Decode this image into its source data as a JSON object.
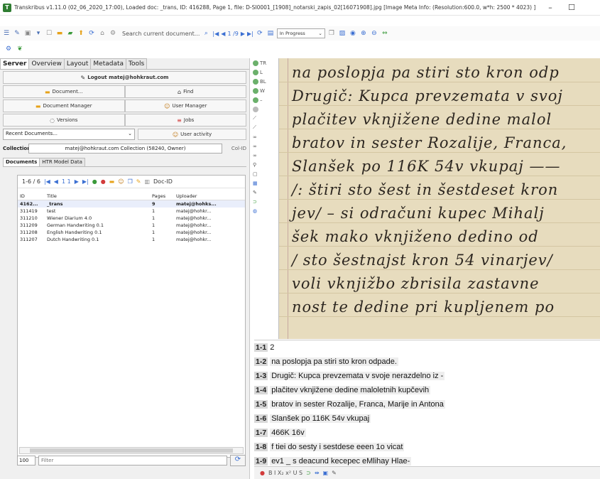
{
  "window": {
    "title": "Transkribus v1.11.0 (02_06_2020_17:00), Loaded doc: _trans, ID: 416288, Page 1, file: D-SI0001_[1908]_notarski_zapis_02[16071908].jpg [Image Meta Info: (Resolution:600.0, w*h: 2500 * 4023) ]",
    "minimize": "–",
    "maximize": "☐"
  },
  "toolbar": {
    "search_placeholder": "Search current document...",
    "page_indicator": "1 /9",
    "status": "In Progress"
  },
  "left_tabs": [
    "Server",
    "Overview",
    "Layout",
    "Metadata",
    "Tools"
  ],
  "server": {
    "logout": "Logout matej@hohkraut.com",
    "document": "Document...",
    "find": "Find",
    "doc_manager": "Document Manager",
    "user_manager": "User Manager",
    "versions": "Versions",
    "jobs": "Jobs",
    "recent": "Recent Documents...",
    "user_activity": "User activity",
    "collections_label": "Collections:",
    "collection_value": "matej@hohkraut.com Collection (58240, Owner)",
    "col_id": "Col-ID"
  },
  "sub_tabs": [
    "Documents",
    "HTR Model Data"
  ],
  "docs": {
    "count": "1-6 / 6",
    "page": "1 1",
    "doc_id": "Doc-ID",
    "columns": [
      "ID",
      "Title",
      "Pages",
      "Uploader"
    ],
    "rows": [
      {
        "id": "4162...",
        "title": "_trans",
        "pages": "9",
        "uploader": "matej@hohks..."
      },
      {
        "id": "311419",
        "title": "test",
        "pages": "1",
        "uploader": "matej@hohkr..."
      },
      {
        "id": "311210",
        "title": "Wiener Diarium 4.0",
        "pages": "1",
        "uploader": "matej@hohkr..."
      },
      {
        "id": "311209",
        "title": "German Handwriting 0.1",
        "pages": "1",
        "uploader": "matej@hohkr..."
      },
      {
        "id": "311208",
        "title": "English Handwriting 0.1",
        "pages": "1",
        "uploader": "matej@hohkr..."
      },
      {
        "id": "311207",
        "title": "Dutch Handwriting 0.1",
        "pages": "1",
        "uploader": "matej@hohkr..."
      }
    ],
    "page_size": "100",
    "filter_placeholder": "Filter"
  },
  "vstrip": [
    "TR",
    "L",
    "BL",
    "W",
    "–",
    "",
    "",
    "",
    "",
    "",
    ""
  ],
  "handwriting": [
    "na poslopja pa stiri sto kron odp",
    "Drugič: Kupca prevzemata v svoj",
    "plačitev vknjižene dedine malol",
    "bratov in sester Rozalije, Franca,",
    "Slanšek po 116K 54v vkupaj ——",
    "/: štiri sto šest in šestdeset kron",
    "jev/ – si odračuni kupec Mihalj",
    "šek mako vknjiženo dedino od",
    "/ sto šestnajst kron 54 vinarjev/",
    "voli vknjižbo zbrisila zastavne",
    "nost te dedine pri kupljenem po"
  ],
  "transcription": [
    {
      "num": "1-1",
      "text": "2"
    },
    {
      "num": "1-2",
      "text": "na poslopja pa stiri sto kron odpade."
    },
    {
      "num": "1-3",
      "text": "Drugič: Kupca prevzemata v svoje nerazdelno iz -"
    },
    {
      "num": "1-4",
      "text": "plačitev vknjižene dedine maloletnih kupčevih"
    },
    {
      "num": "1-5",
      "text": "bratov in sester Rozalije, Franca, Marije in Antona"
    },
    {
      "num": "1-6",
      "text": "Slanšek po 116K 54v vkupaj"
    },
    {
      "num": "1-7",
      "text": "466K 16v"
    },
    {
      "num": "1-8",
      "text": "f tiei do sesty i sestdese eeen 1o vicat"
    },
    {
      "num": "1-9",
      "text": "ev1 _ s deacund kecepec eMlihay Hlae-"
    }
  ],
  "format_bar": "B  I  X₂  x²  U  S"
}
